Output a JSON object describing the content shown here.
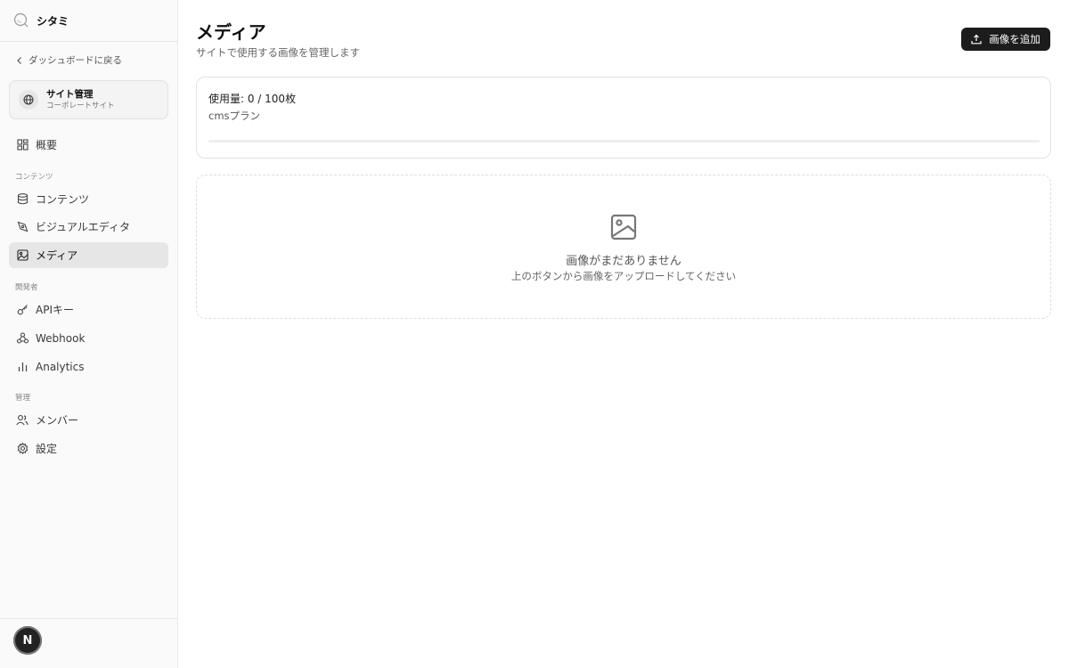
{
  "sidebar": {
    "brand_name": "シタミ",
    "back_label": "ダッシュボードに戻る",
    "site": {
      "title": "サイト管理",
      "subtitle": "コーポレートサイト"
    },
    "overview_label": "概要",
    "sections": {
      "content": "コンテンツ",
      "developer": "開発者",
      "admin": "管理"
    },
    "items": {
      "contents": "コンテンツ",
      "visual_editor": "ビジュアルエディタ",
      "media": "メディア",
      "api_keys": "APIキー",
      "webhook": "Webhook",
      "analytics": "Analytics",
      "members": "メンバー",
      "settings": "設定"
    },
    "active_item": "メディア",
    "avatar_initial": "N"
  },
  "main": {
    "title": "メディア",
    "subtitle": "サイトで使用する画像を管理します",
    "add_button_label": "画像を追加",
    "usage": {
      "label": "使用量: 0 / 100枚",
      "plan": "cmsプラン",
      "used": 0,
      "limit": 100
    },
    "empty_state": {
      "title": "画像がまだありません",
      "subtitle": "上のボタンから画像をアップロードしてください"
    }
  },
  "colors": {
    "accent": "#1c1c1c",
    "sidebar_bg": "#fafafa",
    "active_bg": "#e6e6e6"
  }
}
